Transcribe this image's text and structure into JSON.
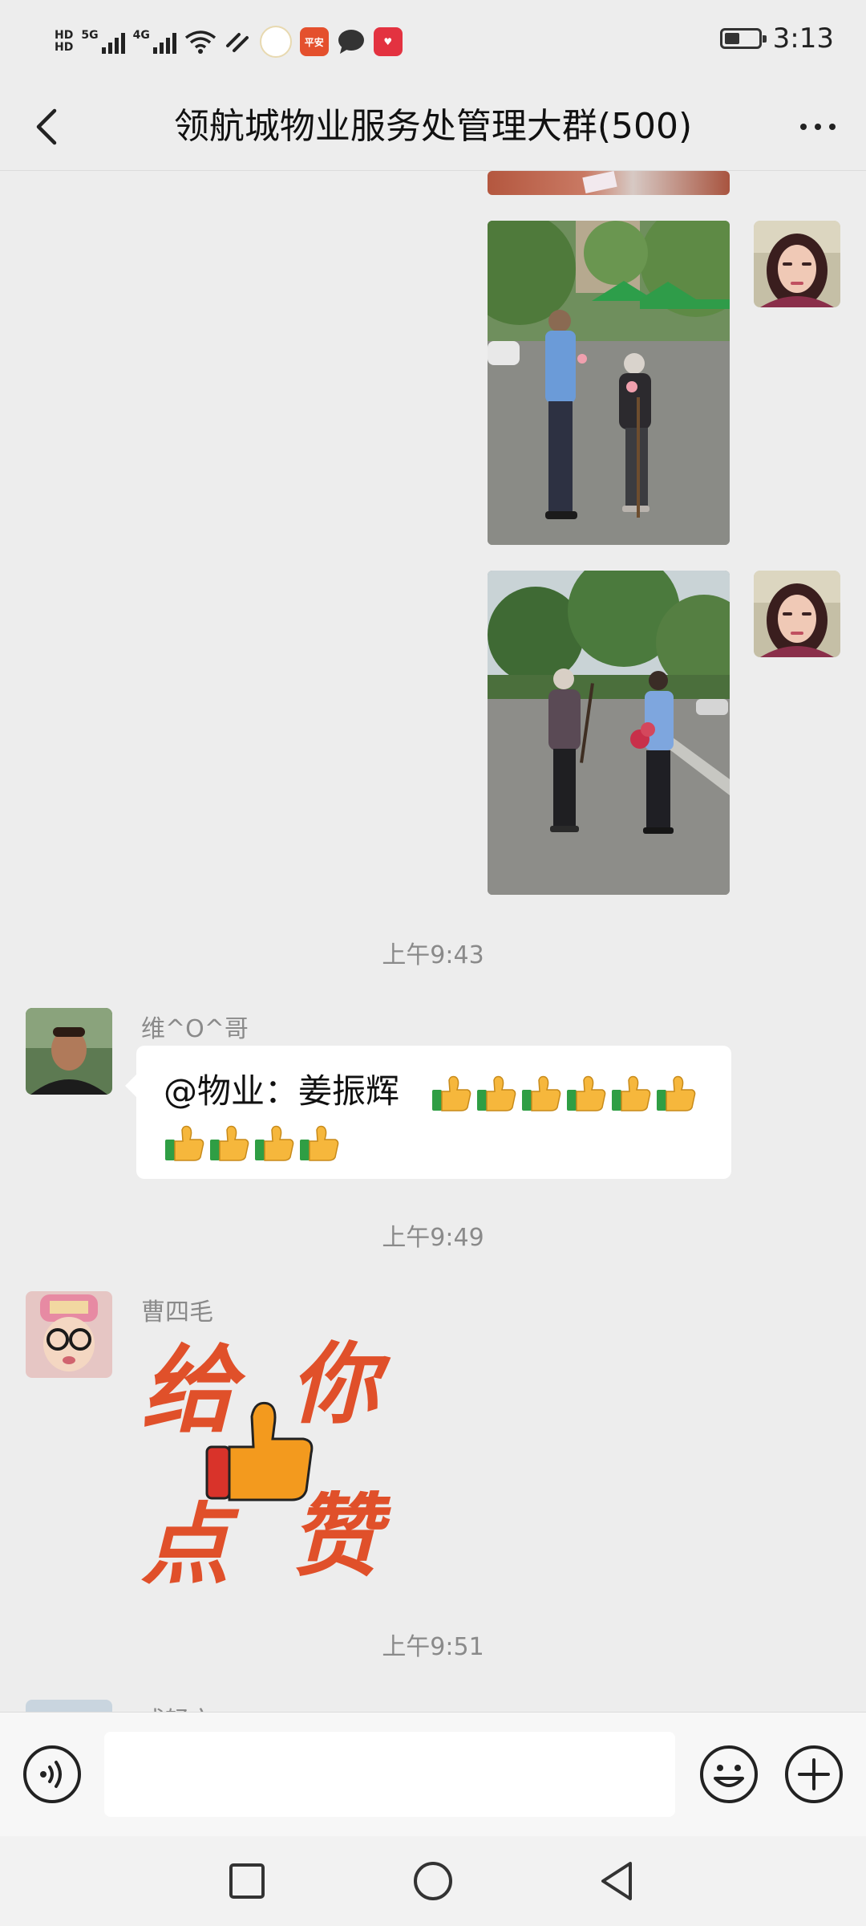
{
  "status_bar": {
    "network_1": "5G",
    "network_2": "4G",
    "hd_1": "HD",
    "hd_2": "HD",
    "time": "3:13",
    "battery_level": 0.45,
    "app_icons": [
      "wifi-icon",
      "data-icon",
      "ping-an-icon",
      "message-icon",
      "health-app-icon"
    ],
    "ping_an_label": "平安\n银行"
  },
  "header": {
    "title": "领航城物业服务处管理大群(500)"
  },
  "messages": [
    {
      "type": "image",
      "side": "right",
      "description": "photo-staff-giving-flower"
    },
    {
      "type": "image",
      "side": "right",
      "description": "photo-staff-giving-flower-2"
    },
    {
      "type": "time",
      "text": "上午9:43"
    },
    {
      "type": "text",
      "side": "left",
      "sender": "维^O^哥",
      "text": "@物业：姜振辉",
      "thumbs_count": 10
    },
    {
      "type": "time",
      "text": "上午9:49"
    },
    {
      "type": "sticker",
      "side": "left",
      "sender": "曹四毛",
      "sticker_text": [
        "给",
        "你",
        "点",
        "赞"
      ]
    },
    {
      "type": "time",
      "text": "上午9:51"
    },
    {
      "type": "partial",
      "side": "left",
      "sender": "成轻文"
    }
  ],
  "colors": {
    "background": "#ededed",
    "bubble": "#ffffff",
    "meta_text": "#8a8a8a",
    "sticker_red": "#e0502a",
    "thumb_orange": "#f39a1e"
  }
}
